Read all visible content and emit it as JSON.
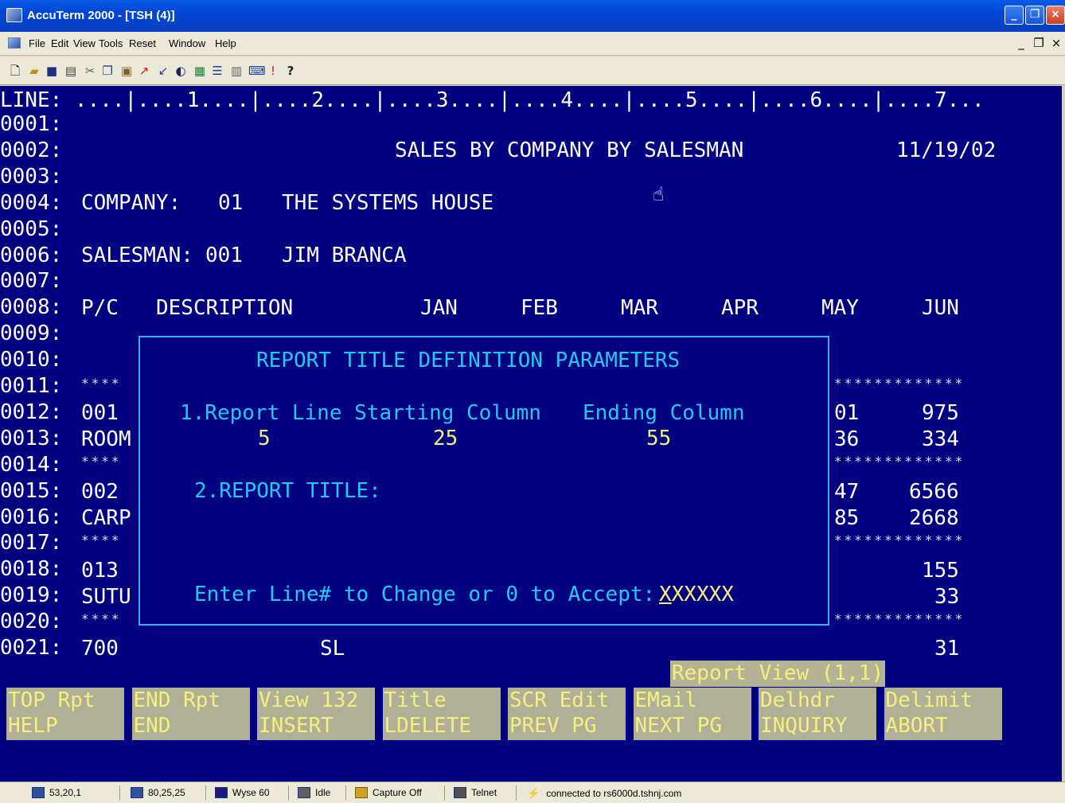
{
  "window": {
    "title": "AccuTerm 2000 - [TSH (4)]",
    "min_glyph": "_",
    "max_glyph": "❐",
    "close_glyph": "×"
  },
  "menu": [
    "File",
    "Edit",
    "View",
    "Tools",
    "Reset",
    "Window",
    "Help"
  ],
  "mdi": {
    "min": "_",
    "restore": "❐",
    "close": "×"
  },
  "toolbar_icons": [
    "new-icon",
    "open-icon",
    "save-icon",
    "print-icon",
    "cut-icon",
    "copy-icon",
    "paste-icon",
    "send-icon",
    "receive-icon",
    "macro-icon",
    "settings-icon",
    "capture-icon",
    "log-icon",
    "keyboard-icon",
    "script-icon",
    "help-icon"
  ],
  "terminal": {
    "ruler": "LINE: ....|....1....|....2....|....3....|....4....|....5....|....6....|....7...",
    "line_numbers": [
      "0001:",
      "0002:",
      "0003:",
      "0004:",
      "0005:",
      "0006:",
      "0007:",
      "0008:",
      "0009:",
      "0010:",
      "0011:",
      "0012:",
      "0013:",
      "0014:",
      "0015:",
      "0016:",
      "0017:",
      "0018:",
      "0019:",
      "0020:",
      "0021:"
    ],
    "report_title": "SALES BY COMPANY BY SALESMAN",
    "report_date": "11/19/02",
    "company_label": "COMPANY:",
    "company_code": "01",
    "company_name": "THE SYSTEMS HOUSE",
    "salesman_label": "SALESMAN:",
    "salesman_code": "001",
    "salesman_name": "JIM BRANCA",
    "headers": [
      "P/C",
      "DESCRIPTION",
      "JAN",
      "FEB",
      "MAR",
      "APR",
      "MAY",
      "JUN"
    ],
    "stars_short": "****",
    "stars_long": "*************",
    "left_col": {
      "r12": "001",
      "r13": "ROOM",
      "r15": "002",
      "r16": "CARP",
      "r18": "013",
      "r19": "SUTU",
      "r21": "700"
    },
    "right_may": {
      "r12": "01",
      "r13": "36",
      "r15": "47",
      "r16": "85"
    },
    "right_jun": {
      "r12": "975",
      "r13": "334",
      "r15": "6566",
      "r16": "2668",
      "r18": "155",
      "r19": "33",
      "r21": "31"
    },
    "r21_mid": "SL"
  },
  "dialog": {
    "title": "REPORT TITLE DEFINITION PARAMETERS",
    "item1_label": "1.Report Line Starting Column",
    "item1_end_label": "Ending Column",
    "item1_line": "5",
    "item1_start": "25",
    "item1_end": "55",
    "item2_label": "2.REPORT TITLE:",
    "prompt": "Enter Line# to Change or 0 to Accept:",
    "prompt_value": "XXXXXX"
  },
  "view_status": "Report View (1,1)",
  "function_keys": [
    {
      "top": "TOP Rpt",
      "bottom": "HELP"
    },
    {
      "top": "END Rpt",
      "bottom": "END"
    },
    {
      "top": "View 132",
      "bottom": "INSERT"
    },
    {
      "top": "Title",
      "bottom": "LDELETE"
    },
    {
      "top": "SCR Edit",
      "bottom": "PREV PG"
    },
    {
      "top": "EMail",
      "bottom": "NEXT PG"
    },
    {
      "top": "Delhdr",
      "bottom": "INQUIRY"
    },
    {
      "top": "Delimit",
      "bottom": "ABORT"
    }
  ],
  "statusbar": {
    "cursor": "53,20,1",
    "size": "80,25,25",
    "emulation": "Wyse 60",
    "state": "Idle",
    "capture": "Capture Off",
    "protocol": "Telnet",
    "connection": "connected to rs6000d.tshnj.com"
  }
}
